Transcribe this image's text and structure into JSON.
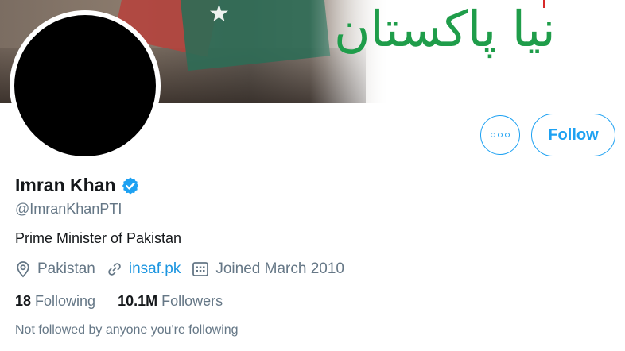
{
  "banner": {
    "slogan": "نیا پاکستان"
  },
  "actions": {
    "more_icon": "more-horizontal-icon",
    "follow_label": "Follow",
    "accent_color": "#1da1f2"
  },
  "profile": {
    "name": "Imran Khan",
    "verified_icon": "verified-badge-icon",
    "handle": "@ImranKhanPTI",
    "bio": "Prime Minister of Pakistan",
    "location": "Pakistan",
    "website": "insaf.pk",
    "joined": "Joined March 2010"
  },
  "stats": {
    "following_count": "18",
    "following_label": "Following",
    "followers_count": "10.1M",
    "followers_label": "Followers"
  },
  "footer_note": "Not followed by anyone you're following"
}
